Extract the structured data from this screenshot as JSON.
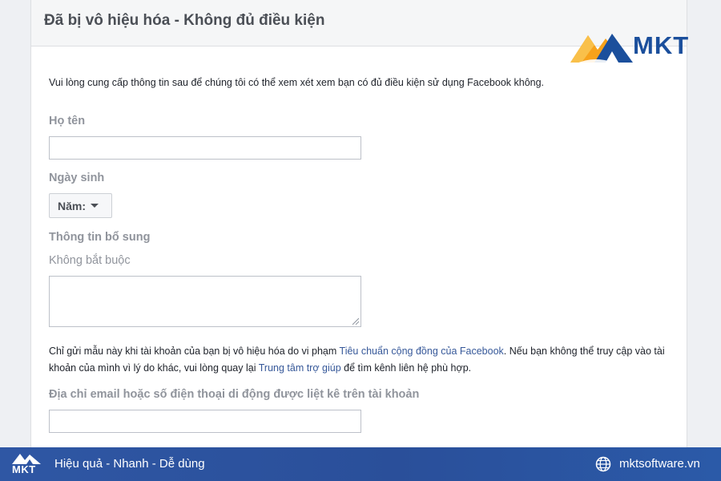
{
  "card": {
    "title": "Đã bị vô hiệu hóa - Không đủ điều kiện",
    "intro": "Vui lòng cung cấp thông tin sau để chúng tôi có thể xem xét xem bạn có đủ điều kiện sử dụng Facebook không."
  },
  "form": {
    "name_label": "Họ tên",
    "name_value": "",
    "dob_label": "Ngày sinh",
    "year_select": "Năm:",
    "extra_label": "Thông tin bổ sung",
    "extra_optional": "Không bắt buộc",
    "extra_value": "",
    "email_label": "Địa chỉ email hoặc số điện thoại di động được liệt kê trên tài khoản",
    "email_value": ""
  },
  "notice": {
    "part1": "Chỉ gửi mẫu này khi tài khoản của bạn bị vô hiệu hóa do vi phạm ",
    "link1": "Tiêu chuẩn cộng đồng của Facebook",
    "part2": ". Nếu bạn không thể truy cập vào tài khoản của mình vì lý do khác, vui lòng quay lại ",
    "link2": "Trung tâm trợ giúp",
    "part3": " để tìm kênh liên hệ phù hợp."
  },
  "brand": {
    "logo_text": "MKT",
    "footer_logo_text": "MKT",
    "slogan": "Hiệu quả - Nhanh - Dễ dùng",
    "site": "mktsoftware.vn"
  },
  "icons": {
    "caret": "caret-down-icon",
    "resize": "resize-grip-icon",
    "globe": "globe-icon",
    "logo_mark": "mountain-logo-icon"
  },
  "colors": {
    "link": "#365899",
    "label_gray": "#90949c",
    "brand_blue": "#1b4f9c",
    "brand_orange": "#f7a21b",
    "footer_blue": "#2f57a4"
  }
}
